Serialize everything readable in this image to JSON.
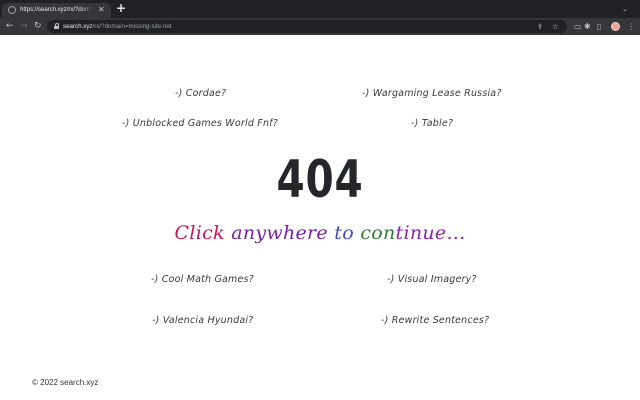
{
  "browser": {
    "tab": {
      "title": "https://search.xyz/rx/?domain...",
      "close_glyph": "✕"
    },
    "new_tab_glyph": "+",
    "address": {
      "host": "search.xyz",
      "path": "/rx/?domain=missing-site.net"
    }
  },
  "page": {
    "status_code": "404",
    "cta_words": [
      {
        "text": "Click ",
        "color": "#c2185b"
      },
      {
        "text": "anywhere ",
        "color": "#7b1fa2"
      },
      {
        "text": "to ",
        "color": "#3f51b5"
      },
      {
        "text": "con",
        "color": "#2e7d32"
      },
      {
        "text": "tinue...",
        "color": "#8e24aa"
      }
    ],
    "links_top": [
      {
        "label": "-) Cordae?"
      },
      {
        "label": "-) Wargaming Lease Russia?"
      },
      {
        "label": "-) Unblocked Games World Fnf?"
      },
      {
        "label": "-) Table?"
      }
    ],
    "links_bottom": [
      {
        "label": "-) Cool Math Games?"
      },
      {
        "label": "-) Visual Imagery?"
      },
      {
        "label": "-) Valencia Hyundai?"
      },
      {
        "label": "-) Rewrite Sentences?"
      }
    ],
    "footer": "© 2022 search.xyz"
  },
  "colors": {
    "chrome_dark": "#202124",
    "chrome_mid": "#35363a",
    "heading": "#25262a"
  }
}
